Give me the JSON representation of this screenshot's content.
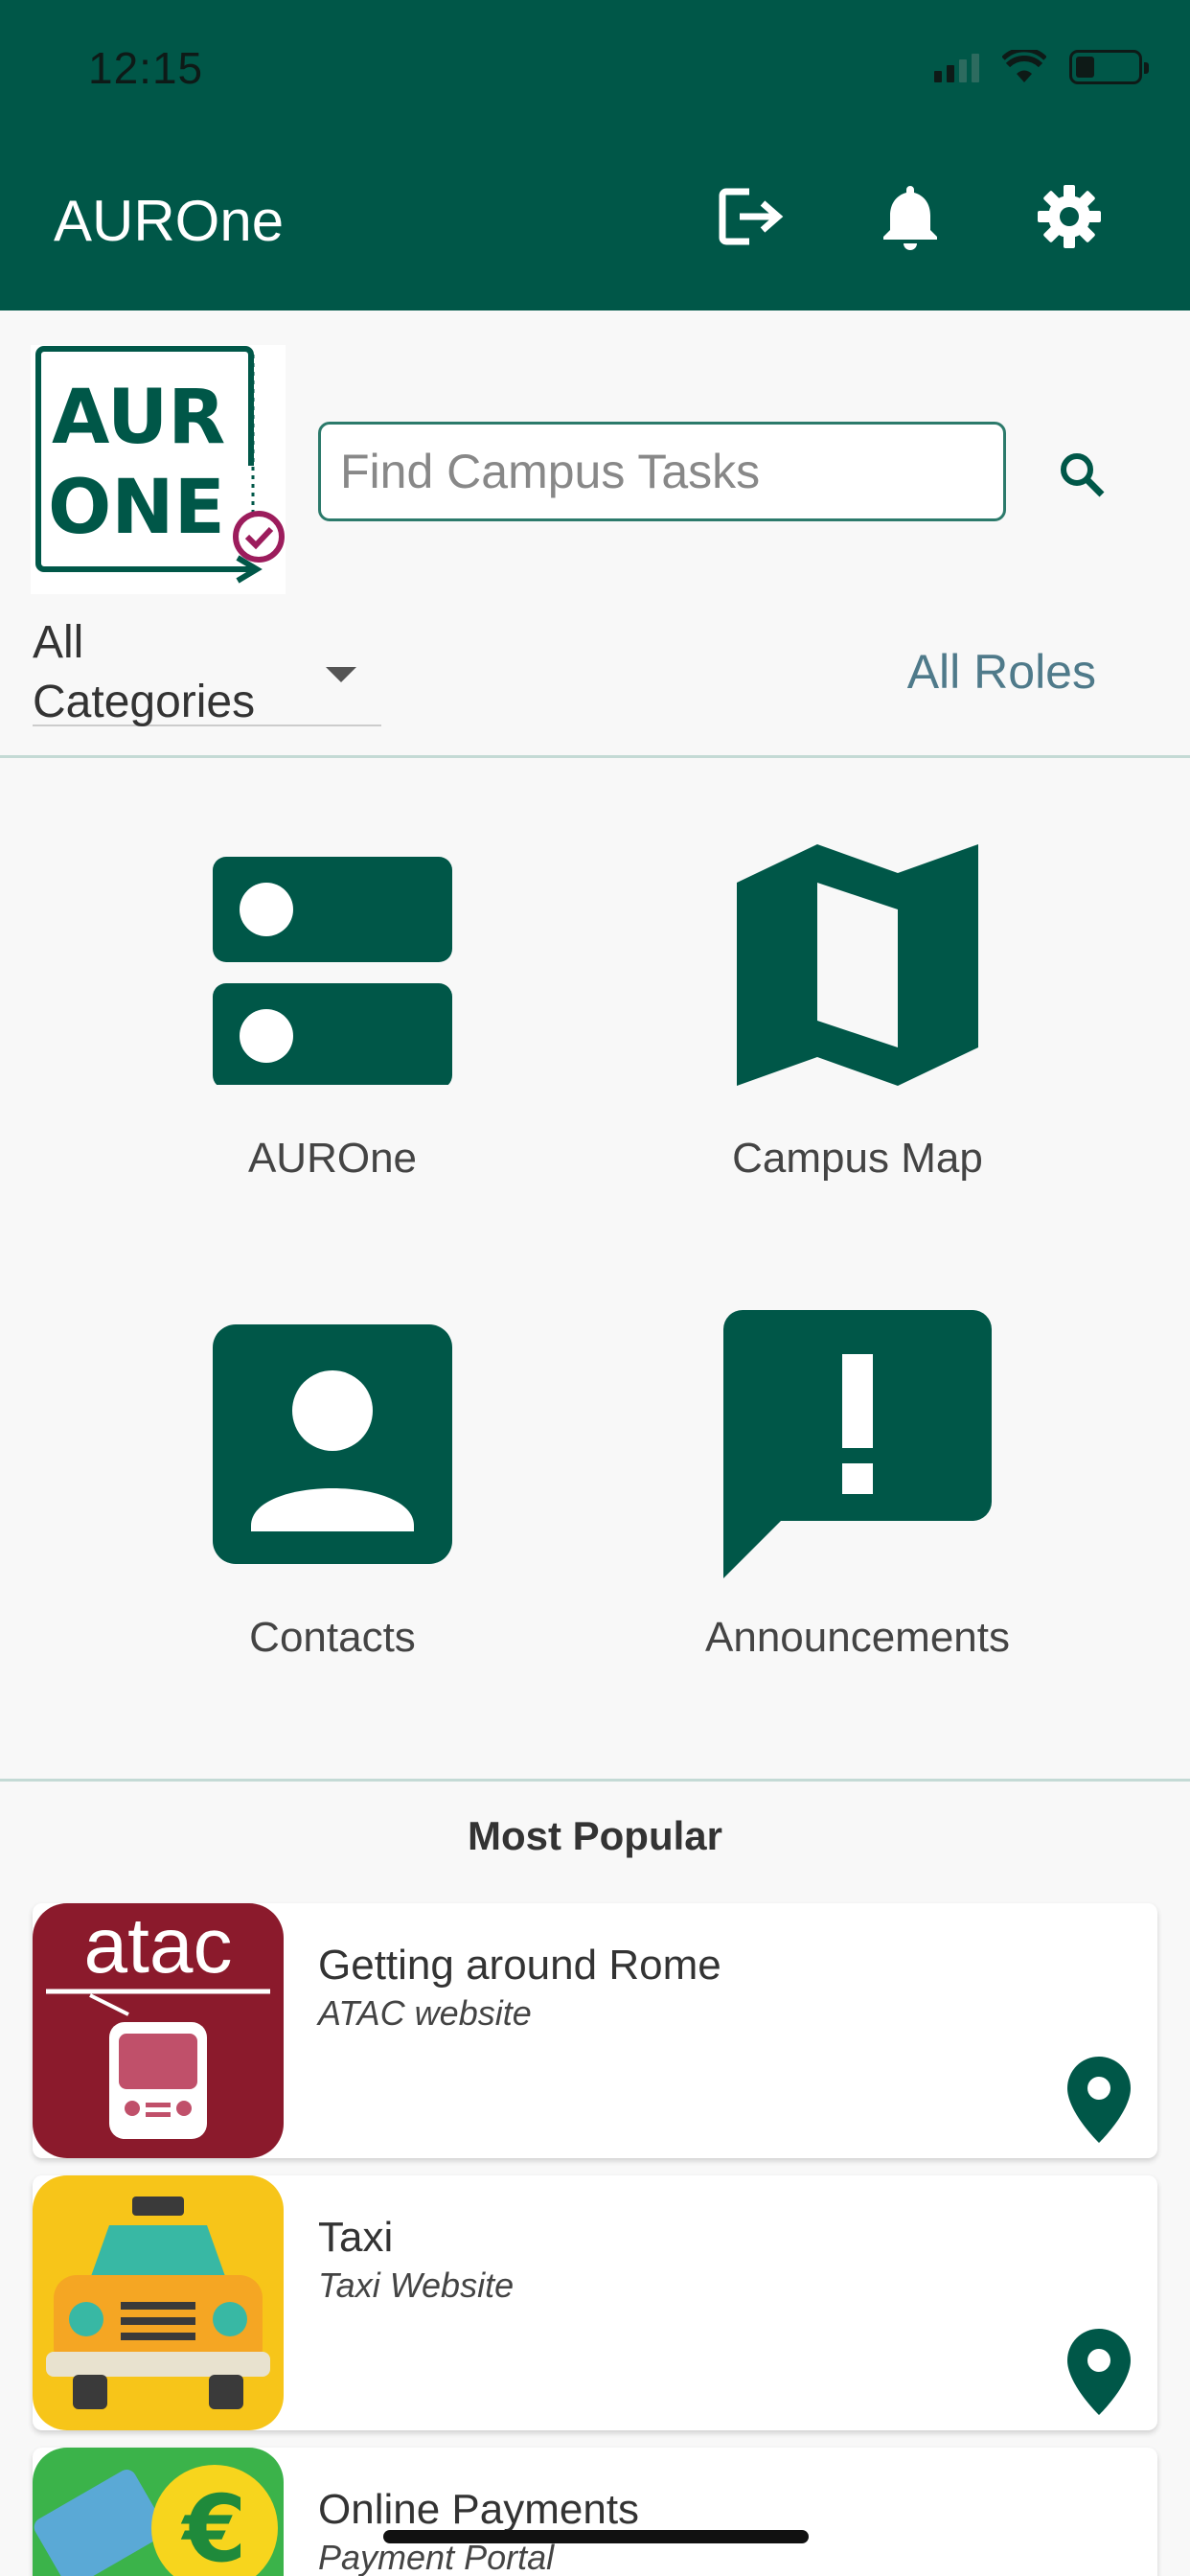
{
  "status": {
    "time": "12:15"
  },
  "header": {
    "title": "AUROne",
    "icons": [
      "logout-icon",
      "bell-icon",
      "gear-icon"
    ]
  },
  "logo": {
    "line1": "AUR",
    "line2": "ONE"
  },
  "search": {
    "placeholder": "Find Campus Tasks",
    "value": ""
  },
  "filters": {
    "category": "All Categories",
    "roles": "All Roles"
  },
  "tiles": [
    {
      "label": "AUROne",
      "icon": "server-icon"
    },
    {
      "label": "Campus Map",
      "icon": "map-icon"
    },
    {
      "label": "Contacts",
      "icon": "contact-icon"
    },
    {
      "label": "Announcements",
      "icon": "announcement-icon"
    }
  ],
  "popular": {
    "title": "Most Popular",
    "items": [
      {
        "title": "Getting around Rome",
        "subtitle": "ATAC website",
        "thumb_text": "atac",
        "icon": "location-pin-icon"
      },
      {
        "title": "Taxi",
        "subtitle": "Taxi Website",
        "thumb_text": "",
        "icon": "location-pin-icon"
      },
      {
        "title": "Online Payments",
        "subtitle": "Payment Portal",
        "thumb_text": "€",
        "icon": ""
      }
    ]
  },
  "colors": {
    "primary": "#005748",
    "accent_magenta": "#9c1c5c",
    "atac_red": "#8b1a2c",
    "taxi_yellow": "#f7c519",
    "link": "#4f7a8a"
  }
}
